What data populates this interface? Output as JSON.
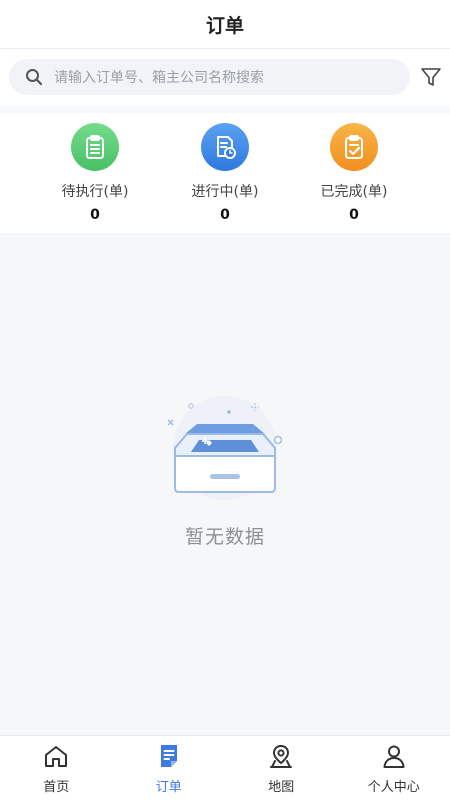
{
  "header": {
    "title": "订单"
  },
  "search": {
    "placeholder": "请输入订单号、箱主公司名称搜索"
  },
  "stats": [
    {
      "label": "待执行(单)",
      "value": "0",
      "icon": "clipboard-list-icon",
      "color": "#5fcf7a"
    },
    {
      "label": "进行中(单)",
      "value": "0",
      "icon": "document-clock-icon",
      "color": "#3f8ae6"
    },
    {
      "label": "已完成(单)",
      "value": "0",
      "icon": "clipboard-check-icon",
      "color": "#f5a02c"
    }
  ],
  "empty": {
    "text": "暂无数据"
  },
  "tabbar": {
    "active_color": "#3d7be0",
    "items": [
      {
        "label": "首页",
        "icon": "home-icon"
      },
      {
        "label": "订单",
        "icon": "order-icon",
        "active": true
      },
      {
        "label": "地图",
        "icon": "map-pin-icon"
      },
      {
        "label": "个人中心",
        "icon": "user-icon"
      }
    ]
  }
}
